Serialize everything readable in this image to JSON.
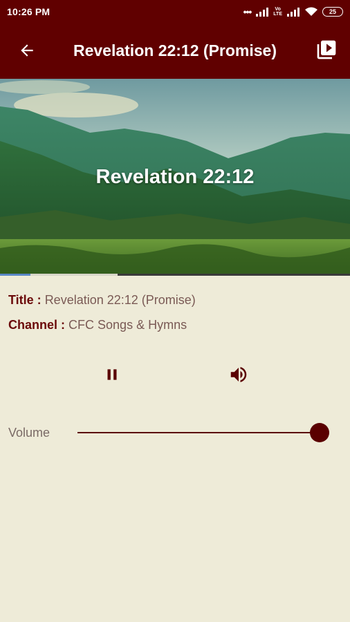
{
  "status_bar": {
    "time": "10:26 PM",
    "dots": "•••",
    "volte_top": "Vo",
    "volte_bottom": "LTE",
    "battery": "25",
    "icons": [
      "signal-icon",
      "volte-icon",
      "signal-icon",
      "wifi-icon",
      "battery-icon"
    ]
  },
  "app_bar": {
    "title": "Revelation 22:12 (Promise)",
    "back_icon": "arrow-back-icon",
    "playlist_icon": "playlist-play-icon"
  },
  "video": {
    "overlay_title": "Revelation 22:12",
    "progress_played": 0.087,
    "progress_buffered": 0.336
  },
  "info": {
    "title_key": "Title :",
    "title_value": "Revelation 22:12 (Promise)",
    "channel_key": "Channel :",
    "channel_value": "CFC Songs & Hymns"
  },
  "controls": {
    "pause_icon": "pause-icon",
    "volume_icon": "volume-up-icon",
    "volume_label": "Volume",
    "volume_level": 1.0
  },
  "colors": {
    "primary": "#600000",
    "background": "#eeebd8",
    "accent": "#5a0000"
  }
}
